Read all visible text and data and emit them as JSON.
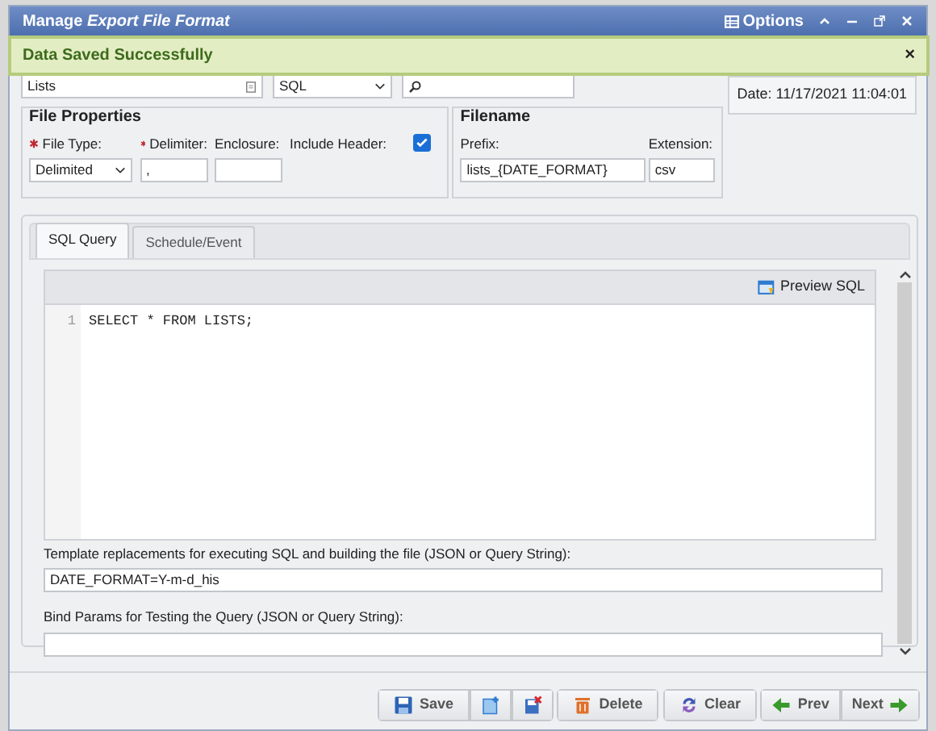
{
  "window": {
    "title_prefix": "Manage",
    "title_emphasis": "Export File Format",
    "options_label": "Options"
  },
  "alert": {
    "message": "Data Saved Successfully",
    "close": "×"
  },
  "top_row": {
    "name_value": "Lists",
    "type_value": "SQL",
    "date": "Date: 11/17/2021 11:04:01"
  },
  "file_properties": {
    "title": "File Properties",
    "file_type_label": "File Type:",
    "file_type_value": "Delimited",
    "delimiter_label": "Delimiter:",
    "delimiter_value": ",",
    "enclosure_label": "Enclosure:",
    "include_header_label": "Include Header:",
    "include_header_checked": true
  },
  "filename": {
    "title": "Filename",
    "prefix_label": "Prefix:",
    "prefix_value": "lists_{DATE_FORMAT}",
    "extension_label": "Extension:",
    "extension_value": "csv"
  },
  "tabs": [
    {
      "label": "SQL Query",
      "selected": true
    },
    {
      "label": "Schedule/Event",
      "selected": false
    }
  ],
  "editor": {
    "preview_label": "Preview SQL",
    "lines": [
      {
        "number": "1",
        "code": "SELECT * FROM LISTS;"
      }
    ]
  },
  "template": {
    "label": "Template replacements for executing SQL and building the file (JSON or Query String):",
    "value": "DATE_FORMAT=Y-m-d_his"
  },
  "bind": {
    "label": "Bind Params for Testing the Query (JSON or Query String):"
  },
  "buttons": [
    {
      "kind": "save",
      "label": "Save"
    },
    {
      "kind": "new"
    },
    {
      "kind": "remove"
    },
    {
      "kind": "delete",
      "label": "Delete"
    },
    {
      "kind": "clear",
      "label": "Clear"
    },
    {
      "kind": "prev",
      "label": "Prev"
    },
    {
      "kind": "next",
      "label": "Next"
    }
  ]
}
